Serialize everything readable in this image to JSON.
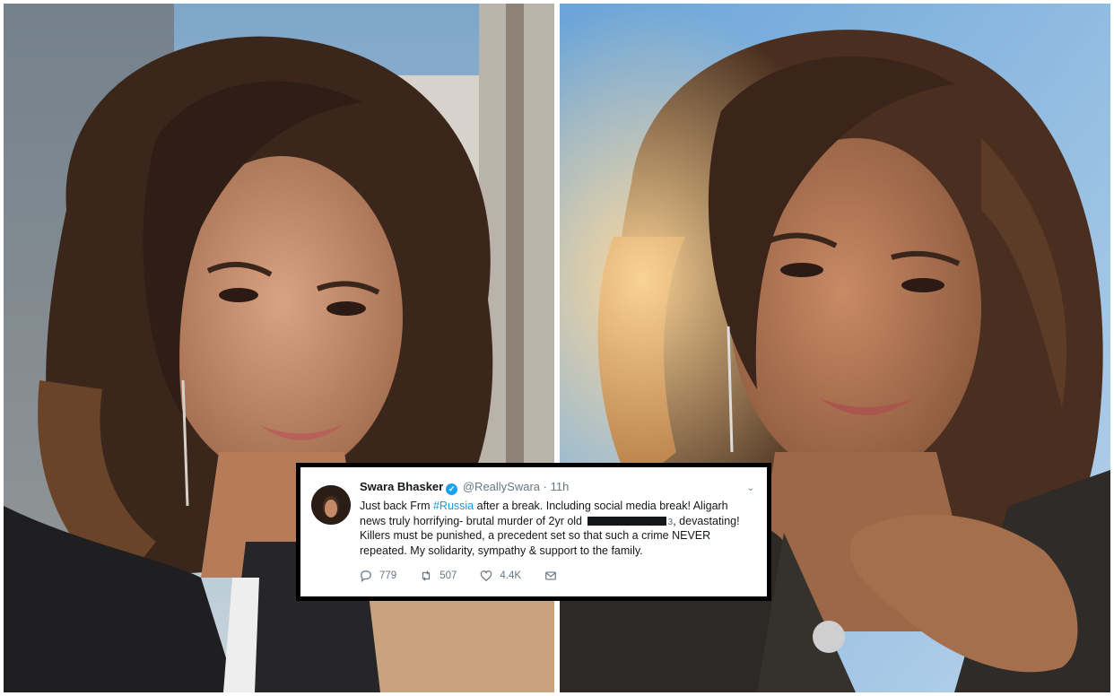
{
  "photos": {
    "left": {
      "icon": "woman-selfie-photo"
    },
    "right": {
      "icon": "woman-selfie-sunlight-photo"
    }
  },
  "tweet": {
    "name": "Swara Bhasker",
    "handle": "@ReallySwara",
    "separator": "·",
    "time": "11h",
    "text_1": "Just back Frm ",
    "hashtag": "#Russia",
    "text_2": " after a break. Including social media break! Aligarh news truly horrifying- brutal murder of 2yr old",
    "redacted_tail": "з",
    "text_3": ", devastating! Killers must be punished, a precedent set so that such a crime NEVER repeated. My solidarity, sympathy & support to the family.",
    "replies": "779",
    "retweets": "507",
    "likes": "4.4K",
    "colors": {
      "link": "#1b95e0",
      "verified": "#1da1f2",
      "muted": "#657786"
    }
  }
}
